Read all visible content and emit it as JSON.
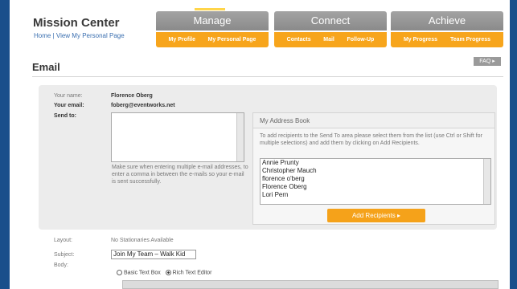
{
  "header": {
    "title": "Mission Center",
    "links": [
      "Home",
      "View My Personal Page"
    ],
    "separator": "|"
  },
  "nav": [
    {
      "label": "Manage",
      "items": [
        "My Profile",
        "My Personal Page"
      ]
    },
    {
      "label": "Connect",
      "items": [
        "Contacts",
        "Mail",
        "Follow-Up"
      ]
    },
    {
      "label": "Achieve",
      "items": [
        "My Progress",
        "Team Progress"
      ]
    }
  ],
  "page": {
    "heading": "Email",
    "faq_label": "FAQ ▸"
  },
  "form": {
    "your_name_label": "Your name:",
    "your_name": "Florence Oberg",
    "your_email_label": "Your email:",
    "your_email": "foberg@eventworks.net",
    "send_to_label": "Send to:",
    "send_to_hint": "Make sure when entering multiple e-mail addresses, to enter a comma in between the e-mails so your e-mail is sent successfully.",
    "layout_label": "Layout:",
    "layout_value": "No Stationaries Available",
    "subject_label": "Subject:",
    "subject_value": "Join My Team – Walk Kid",
    "body_label": "Body:",
    "editor_options": [
      "Basic Text Box",
      "Rich Text Editor"
    ],
    "editor_selected": "Rich Text Editor"
  },
  "address_book": {
    "title": "My Address Book",
    "info": "To add recipients to the Send To area please select them from the list (use Ctrl or Shift for multiple selections) and add them by clicking on Add Recipients.",
    "contacts": [
      "Annie Prunty",
      "Christopher Mauch",
      "florence o'berg",
      "Florence Oberg",
      "Lori Pern"
    ],
    "add_button": "Add Recipients ▸"
  },
  "colors": {
    "accent": "#f7a51c",
    "nav_gray": "#999999",
    "frame_blue": "#1a4f8b"
  }
}
